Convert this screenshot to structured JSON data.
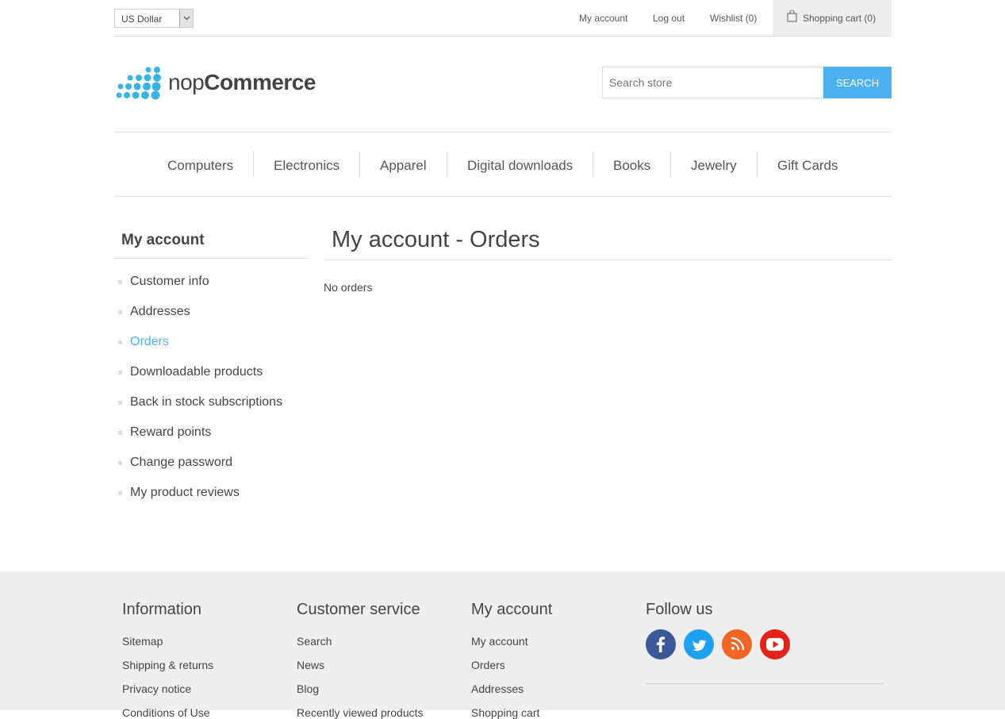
{
  "header": {
    "currency": "US Dollar",
    "links": {
      "my_account": "My account",
      "log_out": "Log out",
      "wishlist": "Wishlist",
      "wishlist_count": "(0)",
      "cart": "Shopping cart",
      "cart_count": "(0)"
    }
  },
  "logo": {
    "text_light": "nop",
    "text_bold": "Commerce"
  },
  "search": {
    "placeholder": "Search store",
    "button": "SEARCH"
  },
  "menu": [
    "Computers",
    "Electronics",
    "Apparel",
    "Digital downloads",
    "Books",
    "Jewelry",
    "Gift Cards"
  ],
  "sidebar": {
    "title": "My account",
    "items": [
      {
        "label": "Customer info"
      },
      {
        "label": "Addresses"
      },
      {
        "label": "Orders",
        "active": true
      },
      {
        "label": "Downloadable products"
      },
      {
        "label": "Back in stock subscriptions"
      },
      {
        "label": "Reward points"
      },
      {
        "label": "Change password"
      },
      {
        "label": "My product reviews"
      }
    ]
  },
  "page": {
    "title": "My account - Orders",
    "empty_text": "No orders"
  },
  "footer": {
    "information": {
      "title": "Information",
      "links": [
        "Sitemap",
        "Shipping & returns",
        "Privacy notice",
        "Conditions of Use"
      ]
    },
    "customer_service": {
      "title": "Customer service",
      "links": [
        "Search",
        "News",
        "Blog",
        "Recently viewed products"
      ]
    },
    "my_account": {
      "title": "My account",
      "links": [
        "My account",
        "Orders",
        "Addresses",
        "Shopping cart"
      ]
    },
    "follow_us": {
      "title": "Follow us",
      "icons": [
        "facebook-icon",
        "twitter-icon",
        "rss-icon",
        "youtube-icon"
      ]
    }
  },
  "colors": {
    "accent": "#4ab2f1",
    "facebook": "#3b5998",
    "twitter": "#1da1f2",
    "rss": "#f26522",
    "youtube": "#e62117"
  }
}
